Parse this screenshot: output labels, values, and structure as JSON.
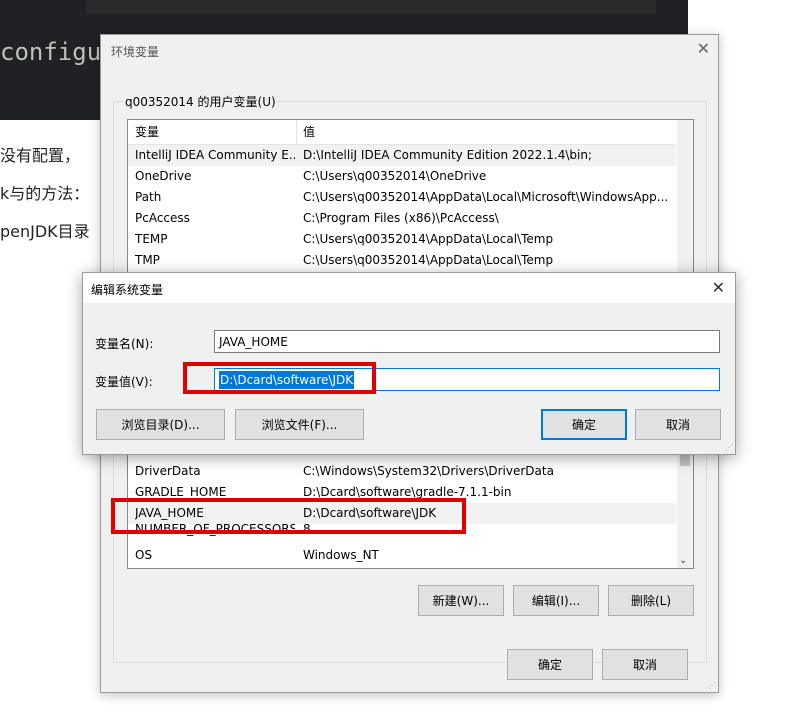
{
  "background": {
    "code_fragment": "configure",
    "lines": [
      "没有配置，",
      "k与的方法：",
      "penJDK目录"
    ]
  },
  "env_window": {
    "title": "环境变量",
    "user_group_label": "q00352014 的用户变量(U)",
    "columns": {
      "name": "变量",
      "value": "值"
    },
    "user_vars": [
      {
        "name": "IntelliJ IDEA Community E...",
        "value": "D:\\IntelliJ IDEA Community Edition 2022.1.4\\bin;"
      },
      {
        "name": "OneDrive",
        "value": "C:\\Users\\q00352014\\OneDrive"
      },
      {
        "name": "Path",
        "value": "C:\\Users\\q00352014\\AppData\\Local\\Microsoft\\WindowsApp..."
      },
      {
        "name": "PcAccess",
        "value": "C:\\Program Files (x86)\\PcAccess\\"
      },
      {
        "name": "TEMP",
        "value": "C:\\Users\\q00352014\\AppData\\Local\\Temp"
      },
      {
        "name": "TMP",
        "value": "C:\\Users\\q00352014\\AppData\\Local\\Temp"
      }
    ],
    "system_vars": [
      {
        "name": "DriverData",
        "value": "C:\\Windows\\System32\\Drivers\\DriverData"
      },
      {
        "name": "GRADLE_HOME",
        "value": "D:\\Dcard\\software\\gradle-7.1.1-bin"
      },
      {
        "name": "JAVA_HOME",
        "value": "D:\\Dcard\\software\\JDK"
      },
      {
        "name": "NUMBER_OF_PROCESSORS",
        "value": "8"
      },
      {
        "name": "OS",
        "value": "Windows_NT"
      }
    ],
    "buttons": {
      "new": "新建(W)...",
      "edit": "编辑(I)...",
      "delete": "删除(L)",
      "ok": "确定",
      "cancel": "取消"
    }
  },
  "edit_dialog": {
    "title": "编辑系统变量",
    "name_label": "变量名(N):",
    "name_value": "JAVA_HOME",
    "value_label": "变量值(V):",
    "value_value": "D:\\Dcard\\software\\JDK",
    "buttons": {
      "browse_dir": "浏览目录(D)...",
      "browse_file": "浏览文件(F)...",
      "ok": "确定",
      "cancel": "取消"
    }
  },
  "colors": {
    "highlight_red": "#e00000",
    "accent": "#0078d7"
  }
}
